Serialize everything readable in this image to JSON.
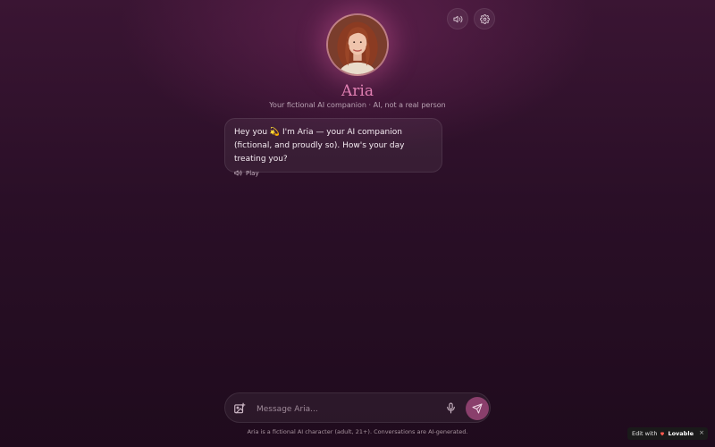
{
  "header": {
    "character_name": "Aria",
    "subtitle": "Your fictional AI companion · AI, not a real person",
    "controls": [
      {
        "icon": "speaker-icon"
      },
      {
        "icon": "gear-icon"
      }
    ]
  },
  "chat": {
    "messages": [
      {
        "sender": "Aria",
        "text": "Hey you 💫 I'm Aria — your AI companion (fictional, and proudly so). How's your day treating you?",
        "play_label": "Play"
      }
    ]
  },
  "composer": {
    "placeholder": "Message Aria...",
    "value": ""
  },
  "footer": {
    "disclaimer": "Aria is a fictional AI character (adult, 21+). Conversations are AI-generated."
  },
  "badge": {
    "prefix": "Edit with",
    "brand": "Lovable",
    "close": "×"
  },
  "colors": {
    "accent": "#e07fb2",
    "send_button": "#8a3f6c",
    "background_top": "#3a1533",
    "background_bottom": "#1f0b1d"
  }
}
